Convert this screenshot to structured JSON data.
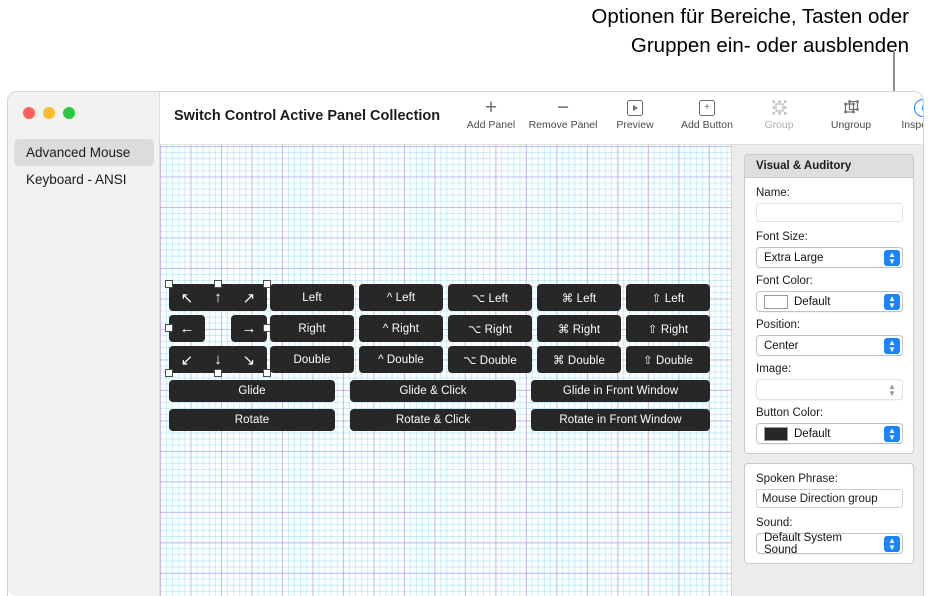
{
  "callout": {
    "text": "Optionen für Bereiche, Tasten oder\nGruppen ein- oder ausblenden"
  },
  "window": {
    "title": "Switch Control Active Panel Collection"
  },
  "sidebar": {
    "items": [
      {
        "label": "Advanced Mouse",
        "selected": true
      },
      {
        "label": "Keyboard - ANSI",
        "selected": false
      }
    ]
  },
  "toolbar": {
    "items": [
      {
        "label": "Add Panel",
        "icon": "plus-icon",
        "state": "enabled"
      },
      {
        "label": "Remove Panel",
        "icon": "minus-icon",
        "state": "enabled"
      },
      {
        "label": "Preview",
        "icon": "play-box-icon",
        "state": "enabled"
      },
      {
        "label": "Add Button",
        "icon": "plus-box-icon",
        "state": "enabled"
      },
      {
        "label": "Group",
        "icon": "group-icon",
        "state": "disabled"
      },
      {
        "label": "Ungroup",
        "icon": "ungroup-icon",
        "state": "enabled"
      },
      {
        "label": "Inspector",
        "icon": "info-icon",
        "state": "accent"
      }
    ]
  },
  "canvas": {
    "arrow_group": {
      "buttons": [
        {
          "glyph": "↖",
          "name": "arrow-up-left"
        },
        {
          "glyph": "↑",
          "name": "arrow-up"
        },
        {
          "glyph": "↗",
          "name": "arrow-up-right"
        },
        {
          "glyph": "←",
          "name": "arrow-left"
        },
        {
          "glyph": "→",
          "name": "arrow-right"
        },
        {
          "glyph": "↙",
          "name": "arrow-down-left"
        },
        {
          "glyph": "↓",
          "name": "arrow-down"
        },
        {
          "glyph": "↘",
          "name": "arrow-down-right"
        }
      ]
    },
    "click_columns": [
      {
        "rows": [
          "Left",
          "Right",
          "Double"
        ]
      },
      {
        "rows": [
          "^ Left",
          "^ Right",
          "^ Double"
        ]
      },
      {
        "rows": [
          "⌥ Left",
          "⌥ Right",
          "⌥ Double"
        ]
      },
      {
        "rows": [
          "⌘ Left",
          "⌘ Right",
          "⌘ Double"
        ]
      },
      {
        "rows": [
          "⇧ Left",
          "⇧ Right",
          "⇧ Double"
        ]
      }
    ],
    "wide_rows": [
      [
        "Glide",
        "Glide & Click",
        "Glide in Front Window"
      ],
      [
        "Rotate",
        "Rotate & Click",
        "Rotate in Front Window"
      ]
    ]
  },
  "inspector": {
    "section_title": "Visual & Auditory",
    "fields": {
      "name_label": "Name:",
      "name_value": "",
      "font_size_label": "Font Size:",
      "font_size_value": "Extra Large",
      "font_color_label": "Font Color:",
      "font_color_value": "Default",
      "font_color_swatch": "#ffffff",
      "position_label": "Position:",
      "position_value": "Center",
      "image_label": "Image:",
      "image_value": "",
      "button_color_label": "Button Color:",
      "button_color_value": "Default",
      "button_color_swatch": "#272727",
      "spoken_phrase_label": "Spoken Phrase:",
      "spoken_phrase_value": "Mouse Direction group",
      "sound_label": "Sound:",
      "sound_value": "Default System Sound"
    }
  },
  "colors": {
    "accent": "#1a84ff",
    "button_fill": "#272727",
    "grid_major": "#be96e1",
    "grid_minor": "#78d7eb"
  }
}
